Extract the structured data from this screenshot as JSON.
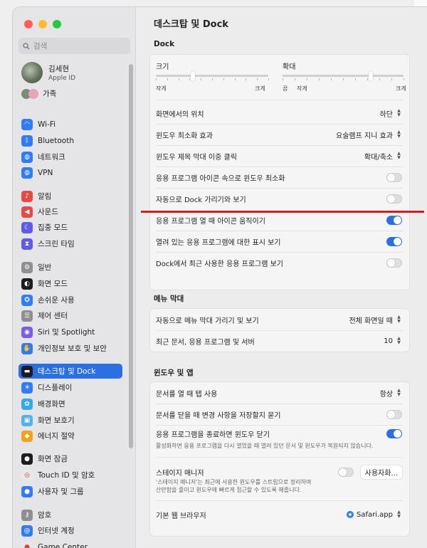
{
  "window": {
    "title": "데스크탑 및 Dock"
  },
  "colors": {
    "accent": "#2b70e3",
    "annotation_line": "#cc1f1f"
  },
  "sidebar": {
    "search_placeholder": "검색",
    "user": {
      "name": "김세현",
      "subtitle": "Apple ID"
    },
    "family": "가족",
    "items": [
      {
        "label": "Wi-Fi",
        "icon": "wifi-icon",
        "color": "#2f7cf6"
      },
      {
        "label": "Bluetooth",
        "icon": "bluetooth-icon",
        "color": "#2f7cf6"
      },
      {
        "label": "네트워크",
        "icon": "globe-icon",
        "color": "#2f7cf6"
      },
      {
        "label": "VPN",
        "icon": "vpn-globe-icon",
        "color": "#2f7cf6"
      },
      {
        "label": "알림",
        "icon": "bell-icon",
        "color": "#e64a45"
      },
      {
        "label": "사운드",
        "icon": "speaker-icon",
        "color": "#e64a45"
      },
      {
        "label": "집중 모드",
        "icon": "moon-icon",
        "color": "#5e5ce6"
      },
      {
        "label": "스크린 타임",
        "icon": "hourglass-icon",
        "color": "#5e5ce6"
      },
      {
        "label": "일반",
        "icon": "gear-icon",
        "color": "#8e8e93"
      },
      {
        "label": "화면 모드",
        "icon": "appearance-icon",
        "color": "#1c1c1e"
      },
      {
        "label": "손쉬운 사용",
        "icon": "accessibility-icon",
        "color": "#2f7cf6"
      },
      {
        "label": "제어 센터",
        "icon": "control-center-icon",
        "color": "#8e8e93"
      },
      {
        "label": "Siri 및 Spotlight",
        "icon": "siri-icon",
        "color": "#7b5ce6"
      },
      {
        "label": "개인정보 보호 및 보안",
        "icon": "hand-icon",
        "color": "#2f7cf6"
      },
      {
        "label": "데스크탑 및 Dock",
        "icon": "dock-icon",
        "color": "#1c1c1e",
        "active": true
      },
      {
        "label": "디스플레이",
        "icon": "display-icon",
        "color": "#2f7cf6"
      },
      {
        "label": "배경화면",
        "icon": "wallpaper-icon",
        "color": "#38a9e8"
      },
      {
        "label": "화면 보호기",
        "icon": "screensaver-icon",
        "color": "#52b3e8"
      },
      {
        "label": "에너지 절약",
        "icon": "lightbulb-icon",
        "color": "#f2a31b"
      },
      {
        "label": "화면 잠금",
        "icon": "lock-icon",
        "color": "#1c1c1e"
      },
      {
        "label": "Touch ID 및 암호",
        "icon": "fingerprint-icon",
        "color": "#e8e8e8"
      },
      {
        "label": "사용자 및 그룹",
        "icon": "users-icon",
        "color": "#2f7cf6"
      },
      {
        "label": "암호",
        "icon": "key-icon",
        "color": "#8e8e93"
      },
      {
        "label": "인터넷 계정",
        "icon": "at-icon",
        "color": "#2f7cf6"
      },
      {
        "label": "Game Center",
        "icon": "game-center-icon",
        "color": "#e8e8e8"
      }
    ]
  },
  "dock": {
    "section_title": "Dock",
    "size": {
      "label": "크기",
      "min": "작게",
      "max": "크게",
      "value": 0.33
    },
    "magnification": {
      "label": "확대",
      "off": "끔",
      "min": "작게",
      "max": "크게",
      "value": 0.73
    },
    "rows": [
      {
        "label": "화면에서의 위치",
        "value": "하단",
        "type": "popup"
      },
      {
        "label": "윈도우 최소화 효과",
        "value": "요술램프 지니 효과",
        "type": "popup"
      },
      {
        "label": "윈도우 제목 막대 이중 클릭",
        "value": "확대/축소",
        "type": "popup"
      },
      {
        "label": "응용 프로그램 아이콘 속으로 윈도우 최소화",
        "on": false,
        "type": "toggle"
      },
      {
        "label": "자동으로 Dock 가리기와 보기",
        "on": false,
        "type": "toggle"
      },
      {
        "label": "응용 프로그램 열 때 아이콘 움직이기",
        "on": true,
        "type": "toggle"
      },
      {
        "label": "열려 있는 응용 프로그램에 대한 표시 보기",
        "on": true,
        "type": "toggle"
      },
      {
        "label": "Dock에서 최근 사용한 응용 프로그램 보기",
        "on": false,
        "type": "toggle"
      }
    ]
  },
  "menubar": {
    "section_title": "메뉴 막대",
    "rows": [
      {
        "label": "자동으로 메뉴 막대 가리기 및 보기",
        "value": "전체 화면일 때"
      },
      {
        "label": "최근 문서, 응용 프로그램 및 서버",
        "value": "10"
      }
    ]
  },
  "windows": {
    "section_title": "윈도우 및 앱",
    "rows": [
      {
        "label": "문서를 열 때 탭 사용",
        "value": "항상"
      },
      {
        "label": "문서를 닫을 때 변경 사항을 저장할지 묻기"
      },
      {
        "label": "응용 프로그램을 종료하면 윈도우 닫기",
        "desc": "활성화하면 응용 프로그램을 다시 열었을 때 열려 있던 문서 및 윈도우가 복원되지 않습니다."
      }
    ],
    "stage_manager": {
      "label": "스테이지 매니저",
      "desc1": "'스테이지 매니저'는 최근에 사용한 윈도우를 스트립으로 정리하여",
      "desc2": "산만함을 줄이고 윈도우에 빠르게 접근할 수 있도록 해줍니다.",
      "button": "사용자화..."
    },
    "browser": {
      "label": "기본 웹 브라우저",
      "value": "Safari.app"
    }
  }
}
